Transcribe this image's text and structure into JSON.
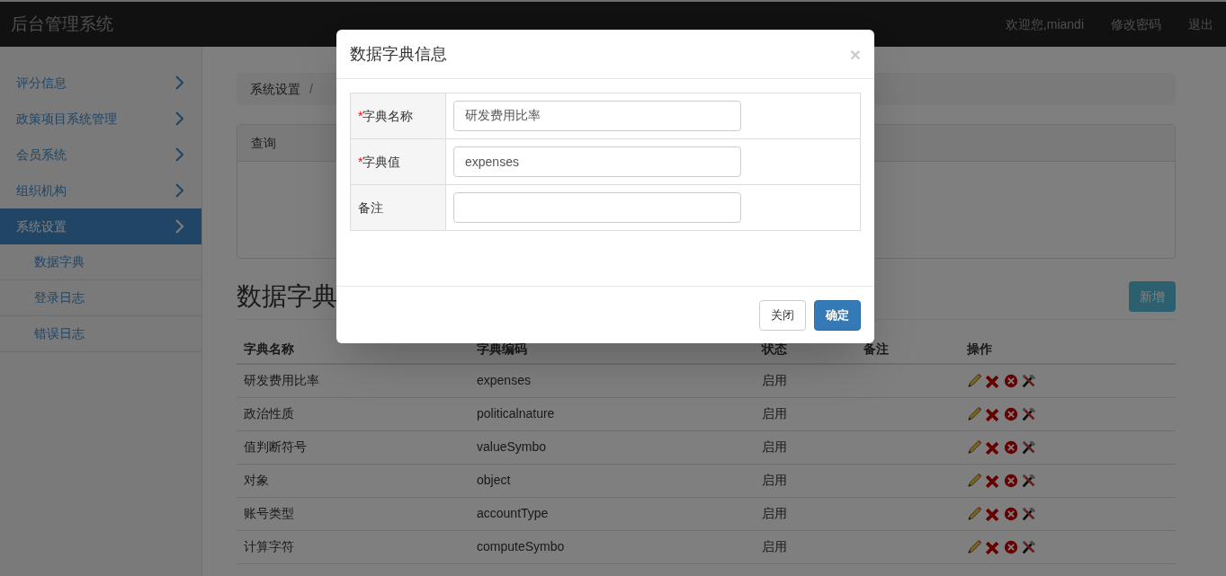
{
  "header": {
    "title": "后台管理系统",
    "links": [
      "欢迎您,miandi",
      "修改密码",
      "退出"
    ]
  },
  "sidebar": {
    "items": [
      {
        "label": "评分信息",
        "selected": false
      },
      {
        "label": "政策项目系统管理",
        "selected": false
      },
      {
        "label": "会员系统",
        "selected": false
      },
      {
        "label": "组织机构",
        "selected": false
      },
      {
        "label": "系统设置",
        "selected": true,
        "children": [
          {
            "label": "数据字典"
          },
          {
            "label": "登录日志"
          },
          {
            "label": "错误日志"
          }
        ]
      }
    ]
  },
  "breadcrumb": {
    "items": [
      "系统设置"
    ],
    "separator": "/"
  },
  "query_panel": {
    "heading": "查询"
  },
  "page_title": "数据字典",
  "add_button": "新增",
  "table": {
    "columns": [
      "字典名称",
      "字典编码",
      "状态",
      "备注",
      "操作"
    ],
    "rows": [
      {
        "name": "研发费用比率",
        "code": "expenses",
        "status": "启用"
      },
      {
        "name": "政治性质",
        "code": "politicalnature",
        "status": "启用"
      },
      {
        "name": "值判断符号",
        "code": "valueSymbo",
        "status": "启用"
      },
      {
        "name": "对象",
        "code": "object",
        "status": "启用"
      },
      {
        "name": "账号类型",
        "code": "accountType",
        "status": "启用"
      },
      {
        "name": "计算字符",
        "code": "computeSymbo",
        "status": "启用"
      }
    ]
  },
  "modal": {
    "title": "数据字典信息",
    "close": "×",
    "fields": [
      {
        "label": "字典名称",
        "required_mark": "*",
        "value": "研发费用比率"
      },
      {
        "label": "字典值",
        "required_mark": "*",
        "value": "expenses"
      },
      {
        "label": "备注"
      }
    ],
    "buttons": [
      {
        "label": "关闭",
        "kind": "default"
      },
      {
        "label": "确定",
        "kind": "primary"
      }
    ]
  }
}
